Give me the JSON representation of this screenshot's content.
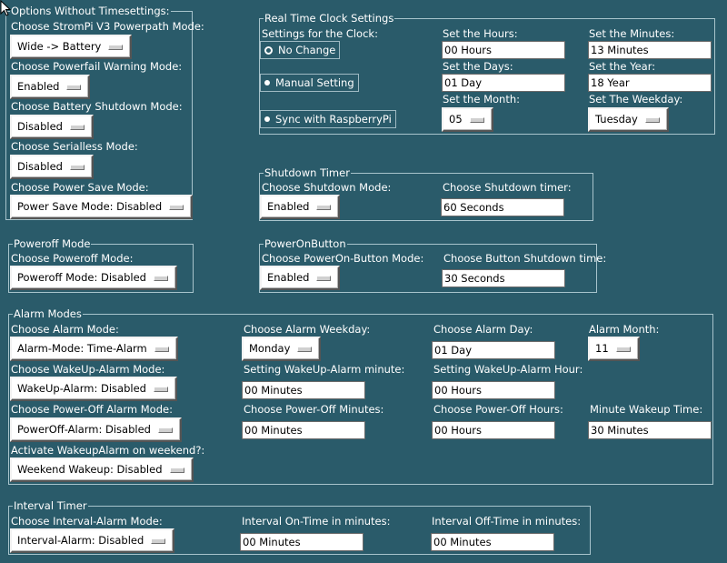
{
  "options_group": {
    "legend": "Options Without Timesettings:",
    "powerpath_label": "Choose StromPi V3 Powerpath Mode:",
    "powerpath_value": "Wide -> Battery",
    "powerfail_label": "Choose Powerfail Warning Mode:",
    "powerfail_value": "Enabled",
    "battery_shutdown_label": "Choose Battery Shutdown Mode:",
    "battery_shutdown_value": "Disabled",
    "serialless_label": "Choose Serialless Mode:",
    "serialless_value": "Disabled",
    "power_save_label": "Choose Power Save Mode:",
    "power_save_value": "Power Save Mode: Disabled"
  },
  "rtc_group": {
    "legend": "Real Time Clock Settings",
    "settings_label": "Settings for the Clock:",
    "radio_no_change": "No Change",
    "radio_manual": "Manual Setting",
    "radio_sync": "Sync with RaspberryPi",
    "hours_label": "Set the Hours:",
    "hours_value": "00 Hours",
    "minutes_label": "Set the Minutes:",
    "minutes_value": "13 Minutes",
    "days_label": "Set the Days:",
    "days_value": "01 Day",
    "year_label": "Set the Year:",
    "year_value": "18 Year",
    "month_label": "Set the Month:",
    "month_value": "05",
    "weekday_label": "Set The Weekday:",
    "weekday_value": "Tuesday"
  },
  "shutdown_group": {
    "legend": "Shutdown Timer",
    "mode_label": "Choose Shutdown Mode:",
    "mode_value": "Enabled",
    "timer_label": "Choose Shutdown timer:",
    "timer_value": "60 Seconds"
  },
  "poweroff_group": {
    "legend": "Poweroff Mode",
    "mode_label": "Choose Poweroff Mode:",
    "mode_value": "Poweroff Mode: Disabled"
  },
  "poweron_group": {
    "legend": "PowerOnButton",
    "mode_label": "Choose PowerOn-Button Mode:",
    "mode_value": "Enabled",
    "time_label": "Choose Button Shutdown time:",
    "time_value": "30 Seconds"
  },
  "alarm_group": {
    "legend": "Alarm Modes",
    "alarm_mode_label": "Choose Alarm Mode:",
    "alarm_mode_value": "Alarm-Mode: Time-Alarm",
    "alarm_weekday_label": "Choose Alarm Weekday:",
    "alarm_weekday_value": "Monday",
    "alarm_day_label": "Choose Alarm Day:",
    "alarm_day_value": "01 Day",
    "alarm_month_label": "Alarm Month:",
    "alarm_month_value": "11",
    "wakeup_mode_label": "Choose WakeUp-Alarm Mode:",
    "wakeup_mode_value": "WakeUp-Alarm: Disabled",
    "wakeup_minute_label": "Setting WakeUp-Alarm minute:",
    "wakeup_minute_value": "00 Minutes",
    "wakeup_hour_label": "Setting WakeUp-Alarm Hour:",
    "wakeup_hour_value": "00 Hours",
    "poweroff_alarm_label": "Choose Power-Off Alarm Mode:",
    "poweroff_alarm_value": "PowerOff-Alarm: Disabled",
    "poweroff_minutes_label": "Choose Power-Off Minutes:",
    "poweroff_minutes_value": "00 Minutes",
    "poweroff_hours_label": "Choose Power-Off Hours:",
    "poweroff_hours_value": "00 Hours",
    "minute_wakeup_label": "Minute Wakeup Time:",
    "minute_wakeup_value": "30 Minutes",
    "weekend_label": "Activate WakeupAlarm on weekend?:",
    "weekend_value": "Weekend Wakeup: Disabled"
  },
  "interval_group": {
    "legend": "Interval Timer",
    "mode_label": "Choose Interval-Alarm Mode:",
    "mode_value": "Interval-Alarm: Disabled",
    "on_time_label": "Interval On-Time in minutes:",
    "on_time_value": "00 Minutes",
    "off_time_label": "Interval Off-Time in minutes:",
    "off_time_value": "00 Minutes"
  },
  "colors": {
    "background": "#2a5b6a",
    "text": "#ffffff",
    "field_background": "#ffffff"
  },
  "icons": {
    "pointer": "mouse-pointer-icon",
    "dropdown": "option-menu-indicator-icon"
  }
}
